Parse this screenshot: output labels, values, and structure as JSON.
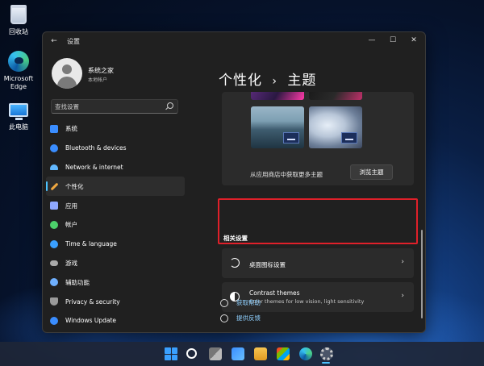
{
  "desktop": {
    "icons": [
      {
        "label": "回收站"
      },
      {
        "label": "Microsoft Edge"
      },
      {
        "label": "此电脑"
      }
    ]
  },
  "window": {
    "title": "设置",
    "profile": {
      "name": "系统之家",
      "subtitle": "本地帐户"
    },
    "search": {
      "placeholder": "查找设置"
    },
    "nav": [
      {
        "label": "系统",
        "color": "#3a8dff"
      },
      {
        "label": "Bluetooth & devices",
        "color": "#3a8dff"
      },
      {
        "label": "Network & internet",
        "color": "#62b8ff"
      },
      {
        "label": "个性化",
        "color": "#f0a840"
      },
      {
        "label": "应用",
        "color": "#8fa8ff"
      },
      {
        "label": "帐户",
        "color": "#4cd06a"
      },
      {
        "label": "Time & language",
        "color": "#3aa0ff"
      },
      {
        "label": "游戏",
        "color": "#aaaaaa"
      },
      {
        "label": "辅助功能",
        "color": "#6fb0ff"
      },
      {
        "label": "Privacy & security",
        "color": "#9a9a9a"
      },
      {
        "label": "Windows Update",
        "color": "#3a8dff"
      }
    ],
    "active_nav": "个性化",
    "breadcrumb": {
      "parent": "个性化",
      "separator": "›",
      "current": "主题"
    },
    "themes": {
      "store_text": "从应用商店中获取更多主题",
      "browse_button": "浏览主题"
    },
    "related": {
      "heading": "相关设置",
      "desktop_icons": "桌面图标设置",
      "contrast_title": "Contrast themes",
      "contrast_sub": "Color themes for low vision, light sensitivity"
    },
    "links": {
      "help": "获取帮助",
      "feedback": "提供反馈"
    }
  }
}
